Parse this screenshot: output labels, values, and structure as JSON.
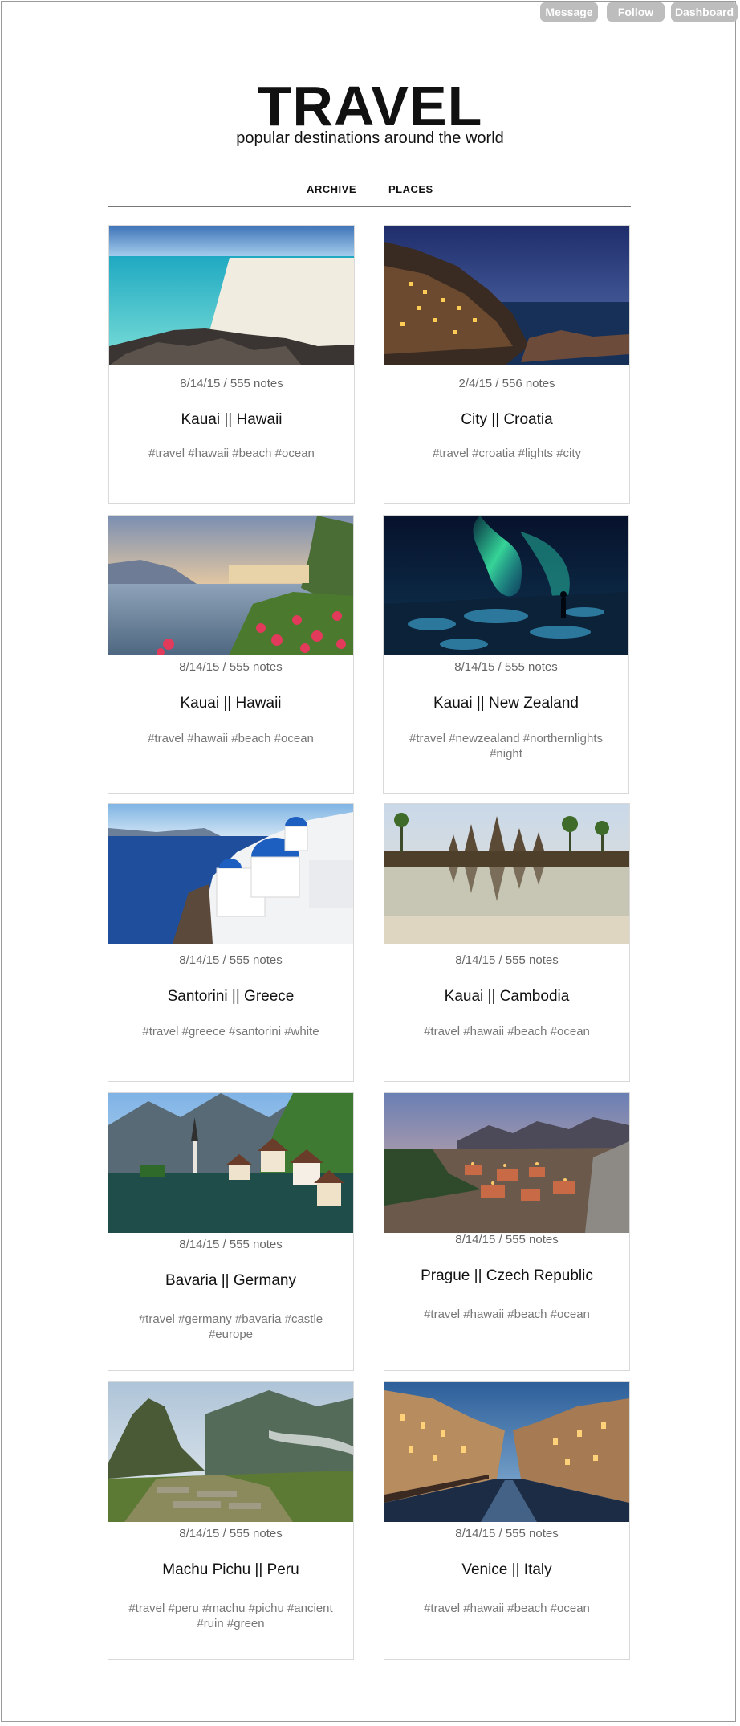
{
  "topbar": {
    "message": "Message",
    "follow": "Follow",
    "dashboard": "Dashboard"
  },
  "header": {
    "title": "TRAVEL",
    "subtitle": "popular destinations around the world"
  },
  "nav": {
    "archive": "ARCHIVE",
    "places": "PLACES"
  },
  "posts": [
    {
      "meta": "8/14/15 / 555 notes",
      "place": "Kauai || Hawaii",
      "tags": "#travel #hawaii #beach #ocean",
      "image": "beach-photo"
    },
    {
      "meta": "2/4/15 / 556 notes",
      "place": "City || Croatia",
      "tags": "#travel #croatia #lights #city",
      "image": "cliff-town-night-photo"
    },
    {
      "meta": "8/14/15 / 555 notes",
      "place": "Kauai || Hawaii",
      "tags": "#travel #hawaii #beach #ocean",
      "image": "lake-flowers-photo"
    },
    {
      "meta": "8/14/15 / 555 notes",
      "place": "Kauai || New Zealand",
      "tags": "#travel #newzealand #northernlights #night",
      "image": "aurora-photo"
    },
    {
      "meta": "8/14/15 / 555 notes",
      "place": "Santorini || Greece",
      "tags": "#travel #greece #santorini #white",
      "image": "santorini-photo"
    },
    {
      "meta": "8/14/15 / 555 notes",
      "place": "Kauai || Cambodia",
      "tags": "#travel #hawaii #beach #ocean",
      "image": "temple-reflection-photo"
    },
    {
      "meta": "8/14/15 / 555 notes",
      "place": "Bavaria || Germany",
      "tags": "#travel #germany #bavaria #castle #europe",
      "image": "alpine-village-photo"
    },
    {
      "meta": "8/14/15 / 555 notes",
      "place": "Prague || Czech Republic",
      "tags": "#travel #hawaii #beach #ocean",
      "image": "coastal-town-dusk-photo"
    },
    {
      "meta": "8/14/15 / 555 notes",
      "place": "Machu Pichu || Peru",
      "tags": "#travel #peru #machu #pichu #ancient #ruin #green",
      "image": "machu-picchu-photo"
    },
    {
      "meta": "8/14/15 / 555 notes",
      "place": "Venice || Italy",
      "tags": "#travel #hawaii #beach #ocean",
      "image": "canal-night-photo"
    }
  ]
}
